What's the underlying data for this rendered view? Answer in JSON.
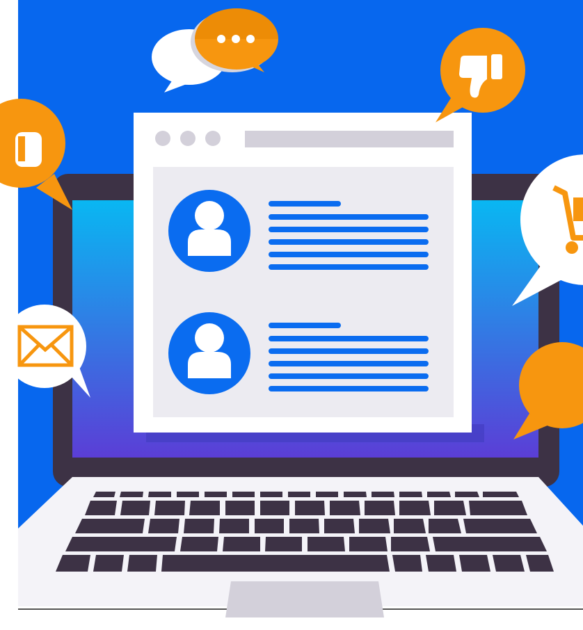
{
  "palette": {
    "background": "#0767ee",
    "laptop_frame": "#3d3245",
    "screen_top": "#09b7f2",
    "screen_bottom": "#5b3ed6",
    "window": "#ffffff",
    "window_panel": "#ecebf1",
    "window_controls": "#d3d0da",
    "accent_blue": "#0a6cf0",
    "bubble_orange": "#f7960f",
    "bubble_orange_dark": "#e68500",
    "bubble_white": "#ffffff",
    "keyboard_deck": "#f4f3f8",
    "keys": "#3d3245",
    "trackpad": "#d3d0da"
  },
  "icons": [
    "chat-bubble-icon",
    "typing-dots-icon",
    "thumbs-down-icon",
    "thumbs-up-icon",
    "shopping-cart-icon",
    "envelope-icon",
    "user-avatar-icon"
  ],
  "window": {
    "controls": [
      "window-control-1",
      "window-control-2",
      "window-control-3"
    ],
    "comments": [
      {
        "avatar": "user-avatar-icon",
        "text_lines": 6
      },
      {
        "avatar": "user-avatar-icon",
        "text_lines": 6
      }
    ]
  }
}
